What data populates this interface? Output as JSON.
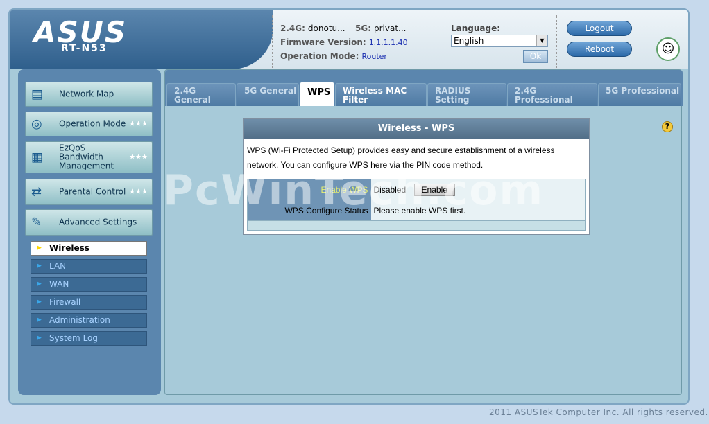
{
  "header": {
    "brand": "ASUS",
    "model": "RT-N53",
    "ssid_24_label": "2.4G:",
    "ssid_24_value": "donotu...",
    "ssid_5_label": "5G:",
    "ssid_5_value": "privat...",
    "firmware_label": "Firmware Version:",
    "firmware_value": "1.1.1.1.40",
    "opmode_label": "Operation Mode:",
    "opmode_value": "Router",
    "language_label": "Language:",
    "language_value": "English",
    "ok_label": "Ok",
    "logout_label": "Logout",
    "reboot_label": "Reboot"
  },
  "sidebar": {
    "items": [
      {
        "label": "Network Map",
        "icon": "network-map-icon"
      },
      {
        "label": "Operation Mode",
        "icon": "router-icon"
      },
      {
        "label": "EzQoS Bandwidth Management",
        "icon": "bandwidth-icon"
      },
      {
        "label": "Parental Control",
        "icon": "parental-control-icon"
      },
      {
        "label": "Advanced Settings",
        "icon": "wrench-icon"
      }
    ],
    "sub": [
      "Wireless",
      "LAN",
      "WAN",
      "Firewall",
      "Administration",
      "System Log"
    ]
  },
  "tabs": [
    "2.4G General",
    "5G General",
    "WPS",
    "Wireless MAC Filter",
    "RADIUS Setting",
    "2.4G Professional",
    "5G Professional"
  ],
  "panel": {
    "title": "Wireless - WPS",
    "desc": "WPS (Wi-Fi Protected Setup) provides easy and secure establishment of a wireless network. You can configure WPS here via the PIN code method.",
    "enable_label": "Enable WPS",
    "enable_value": "Disabled",
    "enable_button": "Enable",
    "status_label": "WPS Configure Status",
    "status_value": "Please enable WPS first."
  },
  "watermark": "PcWinTech.com",
  "footer": "2011 ASUSTek Computer Inc. All rights reserved.",
  "colors": {
    "accent": "#5b86ae",
    "background": "#a7cad9"
  }
}
